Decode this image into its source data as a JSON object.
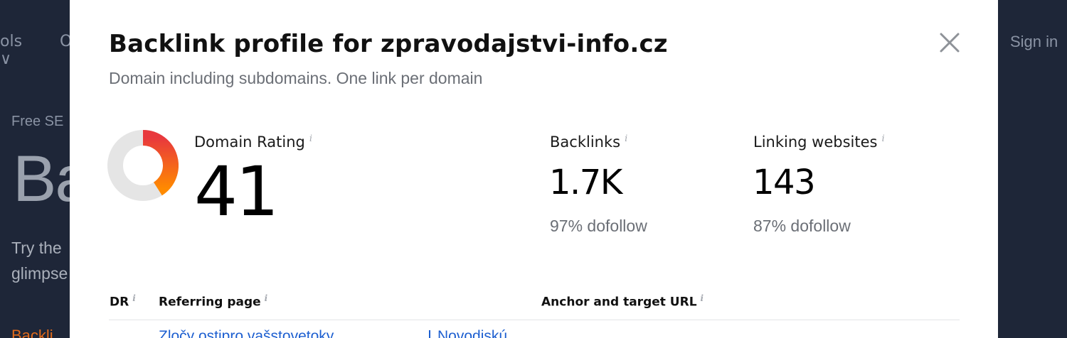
{
  "background": {
    "nav_tools": "ols ∨",
    "nav_o": "O",
    "sign_in": "Sign in",
    "kicker": "Free SE",
    "hero": "Ba",
    "desc_line1": "Try the",
    "desc_line2": "glimpse",
    "orange_text": "Backli"
  },
  "modal": {
    "title": "Backlink profile for zpravodajstvi-info.cz",
    "subtitle": "Domain including subdomains. One link per domain",
    "close_icon": "close-icon",
    "domain_rating": {
      "label": "Domain Rating",
      "value": "41",
      "gauge_fraction": 0.41
    },
    "backlinks": {
      "label": "Backlinks",
      "value": "1.7K",
      "dofollow": "97% dofollow"
    },
    "linking_websites": {
      "label": "Linking websites",
      "value": "143",
      "dofollow": "87% dofollow"
    },
    "table": {
      "headers": [
        "DR",
        "Referring page",
        "Anchor and target URL"
      ],
      "info_symbol": "i",
      "first_row_partial_link": "Zločy ostipro vašstovetoky",
      "first_row_partial_anchor": "Novodiskú"
    }
  },
  "colors": {
    "overlay_bg": "#1e2638",
    "gauge_start": "#e8383d",
    "gauge_end": "#ff8a00",
    "gauge_track": "#e5e5e5",
    "link": "#1d5fd0"
  }
}
